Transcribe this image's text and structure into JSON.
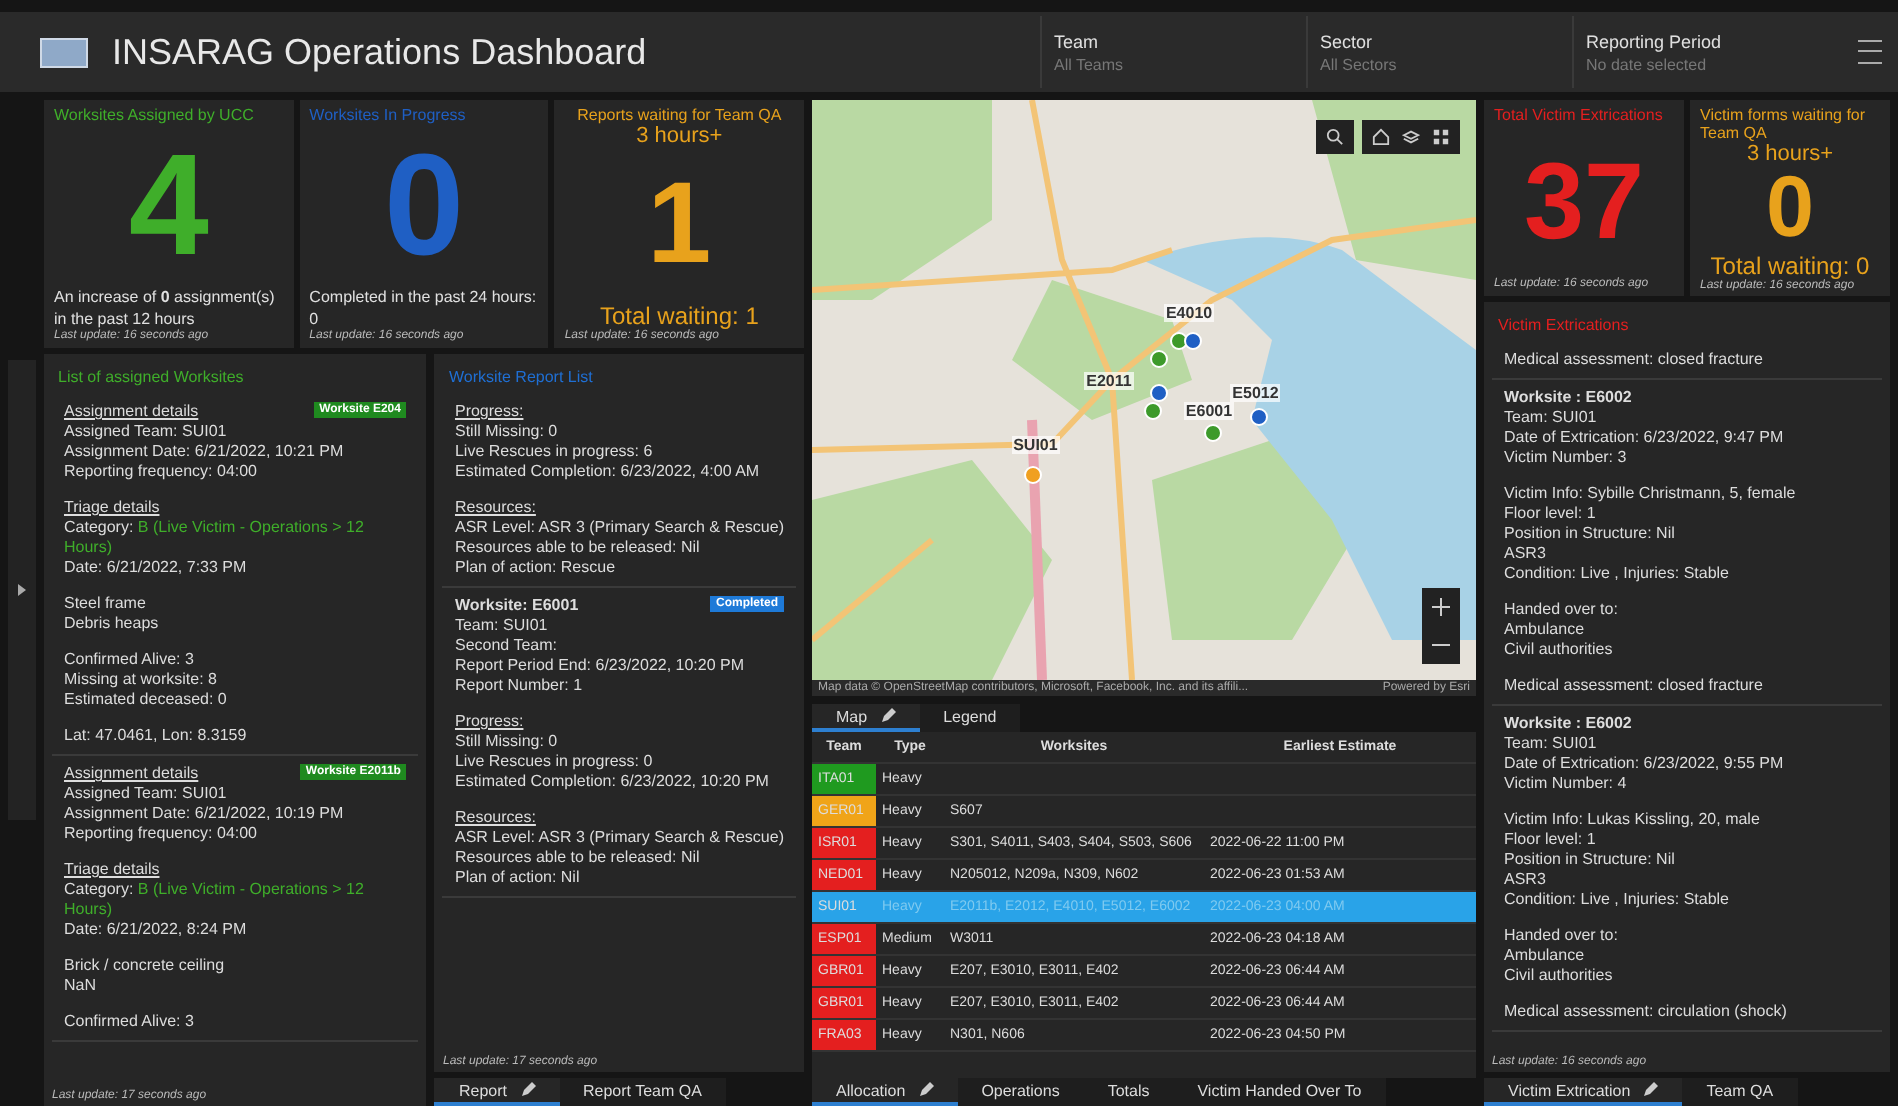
{
  "header": {
    "title": "INSARAG Operations Dashboard",
    "filters": [
      {
        "label": "Team",
        "placeholder": "All Teams"
      },
      {
        "label": "Sector",
        "placeholder": "All Sectors"
      },
      {
        "label": "Reporting Period",
        "placeholder": "No date selected"
      }
    ]
  },
  "indicators": [
    {
      "kind": "count",
      "title": "Worksites Assigned by UCC",
      "color": "#3fae2a",
      "value": "4",
      "footer": "An increase of **0** assignment(s) in the past 12 hours",
      "updated": "Last update: 16 seconds ago"
    },
    {
      "kind": "count",
      "title": "Worksites In Progress",
      "color": "#1f5fc4",
      "value": "0",
      "footer": "Completed in the past 24 hours:  0",
      "updated": "Last update: 16 seconds ago"
    },
    {
      "kind": "waiting",
      "title": "Reports waiting for Team QA",
      "color": "#e8a21c",
      "subtitle": "3 hours+",
      "value": "1",
      "footer": "Total waiting: 1",
      "updated": "Last update: 16 seconds ago"
    }
  ],
  "assigned_list": {
    "title": "List of assigned Worksites",
    "updated": "Last update: 17 seconds ago",
    "cards": [
      {
        "badge": "Worksite E204",
        "blocks": [
          [
            {
              "kind": "heading",
              "text": "Assignment details"
            },
            {
              "kind": "text",
              "text": "Assigned Team:  SUI01"
            },
            {
              "kind": "text",
              "text": "Assignment Date: 6/21/2022, 10:21 PM"
            },
            {
              "kind": "text",
              "text": "Reporting frequency: 04:00"
            }
          ],
          [
            {
              "kind": "heading",
              "text": "Triage details"
            },
            {
              "kind": "category",
              "text": "Category:",
              "value": "B (Live Victim - Operations > 12 Hours)"
            },
            {
              "kind": "text",
              "text": "Date:  6/21/2022, 7:33 PM"
            }
          ],
          [
            {
              "kind": "text",
              "text": "Steel frame"
            },
            {
              "kind": "text",
              "text": "Debris heaps"
            }
          ],
          [
            {
              "kind": "text",
              "text": "Confirmed Alive:  3"
            },
            {
              "kind": "text",
              "text": "Missing at worksite:  8"
            },
            {
              "kind": "text",
              "text": "Estimated deceased: 0"
            }
          ],
          [
            {
              "kind": "text",
              "text": "Lat: 47.0461, Lon: 8.3159"
            }
          ]
        ]
      },
      {
        "badge": "Worksite E2011b",
        "blocks": [
          [
            {
              "kind": "heading",
              "text": "Assignment details"
            },
            {
              "kind": "text",
              "text": "Assigned Team:  SUI01"
            },
            {
              "kind": "text",
              "text": "Assignment Date: 6/21/2022, 10:19 PM"
            },
            {
              "kind": "text",
              "text": "Reporting frequency: 04:00"
            }
          ],
          [
            {
              "kind": "heading",
              "text": "Triage details"
            },
            {
              "kind": "category",
              "text": "Category:",
              "value": "B (Live Victim - Operations > 12 Hours)"
            },
            {
              "kind": "text",
              "text": "Date:  6/21/2022, 8:24 PM"
            }
          ],
          [
            {
              "kind": "text",
              "text": "Brick / concrete ceiling"
            },
            {
              "kind": "text",
              "text": "NaN"
            }
          ],
          [
            {
              "kind": "text",
              "text": "Confirmed Alive:  3"
            }
          ]
        ]
      }
    ]
  },
  "report_list": {
    "title": "Worksite Report List",
    "updated": "Last update: 17 seconds ago",
    "cards": [
      {
        "blocks": [
          [
            {
              "kind": "heading",
              "text": "Progress:"
            },
            {
              "kind": "text",
              "text": "Still Missing:  0"
            },
            {
              "kind": "text",
              "text": "Live Rescues in progress:  6"
            },
            {
              "kind": "text",
              "text": "Estimated Completion:  6/23/2022, 4:00 AM"
            }
          ],
          [
            {
              "kind": "heading",
              "text": "Resources:"
            },
            {
              "kind": "text",
              "text": "ASR Level:  ASR 3 (Primary Search & Rescue)"
            },
            {
              "kind": "text",
              "text": "Resources able to be released:  Nil"
            },
            {
              "kind": "text",
              "text": "Plan of action:  Rescue"
            }
          ]
        ]
      },
      {
        "badge": "Completed",
        "blocks": [
          [
            {
              "kind": "title",
              "text": "Worksite: E6001"
            },
            {
              "kind": "text",
              "text": "Team:  SUI01"
            },
            {
              "kind": "text",
              "text": "Second Team:"
            },
            {
              "kind": "text",
              "text": "Report Period End:  6/23/2022, 10:20 PM"
            },
            {
              "kind": "text",
              "text": "Report Number:  1"
            }
          ],
          [
            {
              "kind": "heading",
              "text": "Progress:"
            },
            {
              "kind": "text",
              "text": "Still Missing:  0"
            },
            {
              "kind": "text",
              "text": "Live Rescues in progress:  0"
            },
            {
              "kind": "text",
              "text": "Estimated Completion:  6/23/2022, 10:20 PM"
            }
          ],
          [
            {
              "kind": "heading",
              "text": "Resources:"
            },
            {
              "kind": "text",
              "text": "ASR Level:  ASR 3 (Primary Search & Rescue)"
            },
            {
              "kind": "text",
              "text": "Resources able to be released:  Nil"
            },
            {
              "kind": "text",
              "text": "Plan of action:  Nil"
            }
          ]
        ]
      }
    ]
  },
  "left_tabs": [
    {
      "label": "Report",
      "selected": true,
      "editable": true
    },
    {
      "label": "Report Team QA",
      "selected": false,
      "editable": false
    }
  ],
  "map": {
    "labels": [
      {
        "text": "E4010"
      },
      {
        "text": "E2011"
      },
      {
        "text": "E6001"
      },
      {
        "text": "E5012"
      },
      {
        "text": "SUI01"
      }
    ],
    "dots": [
      {
        "color": "#3d9a2a"
      },
      {
        "color": "#1f5fc4"
      },
      {
        "color": "#3d9a2a"
      },
      {
        "color": "#1f5fc4"
      },
      {
        "color": "#3d9a2a"
      },
      {
        "color": "#3d9a2a"
      },
      {
        "color": "#1f5fc4"
      },
      {
        "color": "#f0a020"
      }
    ],
    "attribution": "Map data © OpenStreetMap contributors, Microsoft, Facebook, Inc. and its affili...",
    "powered": "Powered by Esri"
  },
  "map_tabs": [
    {
      "label": "Map",
      "selected": true,
      "editable": true
    },
    {
      "label": "Legend",
      "selected": false,
      "editable": false
    }
  ],
  "table": {
    "columns": [
      "Team",
      "Type",
      "Worksites",
      "Earliest Estimate"
    ],
    "rows": [
      {
        "team": "ITA01",
        "color": "#1f9a1f",
        "type": "Heavy",
        "worksites": "",
        "estimate": "",
        "selected": false
      },
      {
        "team": "GER01",
        "color": "#f0a418",
        "type": "Heavy",
        "worksites": "S607",
        "estimate": "",
        "selected": false
      },
      {
        "team": "ISR01",
        "color": "#e41f1f",
        "type": "Heavy",
        "worksites": "S301, S4011, S403, S404, S503, S606",
        "estimate": "2022-06-22 11:00 PM",
        "selected": false
      },
      {
        "team": "NED01",
        "color": "#e41f1f",
        "type": "Heavy",
        "worksites": "N205012, N209a, N309, N602",
        "estimate": "2022-06-23 01:53 AM",
        "selected": false
      },
      {
        "team": "SUI01",
        "color": "#29a3e8",
        "type": "Heavy",
        "worksites": "E2011b, E2012, E4010, E5012, E6002",
        "estimate": "2022-06-23 04:00 AM",
        "selected": true
      },
      {
        "team": "ESP01",
        "color": "#e41f1f",
        "type": "Medium",
        "worksites": "W3011",
        "estimate": "2022-06-23 04:18 AM",
        "selected": false
      },
      {
        "team": "GBR01",
        "color": "#e41f1f",
        "type": "Heavy",
        "worksites": "E207, E3010, E3011, E402",
        "estimate": "2022-06-23 06:44 AM",
        "selected": false
      },
      {
        "team": "GBR01",
        "color": "#e41f1f",
        "type": "Heavy",
        "worksites": "E207, E3010, E3011, E402",
        "estimate": "2022-06-23 06:44 AM",
        "selected": false
      },
      {
        "team": "FRA03",
        "color": "#e41f1f",
        "type": "Heavy",
        "worksites": "N301, N606",
        "estimate": "2022-06-23 04:50 PM",
        "selected": false
      }
    ]
  },
  "center_tabs": [
    {
      "label": "Allocation",
      "selected": true,
      "editable": true
    },
    {
      "label": "Operations",
      "selected": false,
      "editable": false
    },
    {
      "label": "Totals",
      "selected": false,
      "editable": false
    },
    {
      "label": "Victim Handed Over To",
      "selected": false,
      "editable": false
    }
  ],
  "right_indicators": [
    {
      "kind": "count",
      "title": "Total Victim Extrications",
      "color": "#e41f1f",
      "value": "37",
      "updated": "Last update: 16 seconds ago"
    },
    {
      "kind": "waiting",
      "title": "Victim forms waiting for Team QA",
      "color": "#e8a21c",
      "subtitle": "3 hours+",
      "value": "0",
      "footer": "Total waiting: 0",
      "updated": "Last update: 16 seconds ago"
    }
  ],
  "victim_list": {
    "title": "Victim Extrications",
    "updated": "Last update: 16 seconds ago",
    "cards": [
      {
        "blocks": [
          [
            {
              "kind": "text",
              "text": "Medical assessment: closed fracture"
            }
          ]
        ]
      },
      {
        "blocks": [
          [
            {
              "kind": "title",
              "text": "Worksite : E6002"
            },
            {
              "kind": "text",
              "text": "Team: SUI01"
            },
            {
              "kind": "text",
              "text": "Date of Extrication:  6/23/2022, 9:47 PM"
            },
            {
              "kind": "text",
              "text": "Victim Number: 3"
            }
          ],
          [
            {
              "kind": "text",
              "text": "Victim Info: Sybille Christmann, 5, female"
            },
            {
              "kind": "text",
              "text": "Floor level:  1"
            },
            {
              "kind": "text",
              "text": "Position in Structure:  Nil"
            },
            {
              "kind": "text",
              "text": "ASR3"
            },
            {
              "kind": "text",
              "text": "Condition: Live , Injuries: Stable"
            }
          ],
          [
            {
              "kind": "text",
              "text": "Handed over to:"
            },
            {
              "kind": "text",
              "text": "Ambulance"
            },
            {
              "kind": "text",
              "text": "Civil authorities"
            }
          ],
          [
            {
              "kind": "text",
              "text": "Medical assessment: closed fracture"
            }
          ]
        ]
      },
      {
        "blocks": [
          [
            {
              "kind": "title",
              "text": "Worksite : E6002"
            },
            {
              "kind": "text",
              "text": "Team: SUI01"
            },
            {
              "kind": "text",
              "text": "Date of Extrication:  6/23/2022, 9:55 PM"
            },
            {
              "kind": "text",
              "text": "Victim Number: 4"
            }
          ],
          [
            {
              "kind": "text",
              "text": "Victim Info: Lukas Kissling, 20, male"
            },
            {
              "kind": "text",
              "text": "Floor level:  1"
            },
            {
              "kind": "text",
              "text": "Position in Structure:  Nil"
            },
            {
              "kind": "text",
              "text": "ASR3"
            },
            {
              "kind": "text",
              "text": "Condition: Live , Injuries: Stable"
            }
          ],
          [
            {
              "kind": "text",
              "text": "Handed over to:"
            },
            {
              "kind": "text",
              "text": "Ambulance"
            },
            {
              "kind": "text",
              "text": "Civil authorities"
            }
          ],
          [
            {
              "kind": "text",
              "text": "Medical assessment: circulation (shock)"
            }
          ]
        ]
      }
    ]
  },
  "right_tabs": [
    {
      "label": "Victim Extrication",
      "selected": true,
      "editable": true
    },
    {
      "label": "Team QA",
      "selected": false,
      "editable": false
    }
  ]
}
